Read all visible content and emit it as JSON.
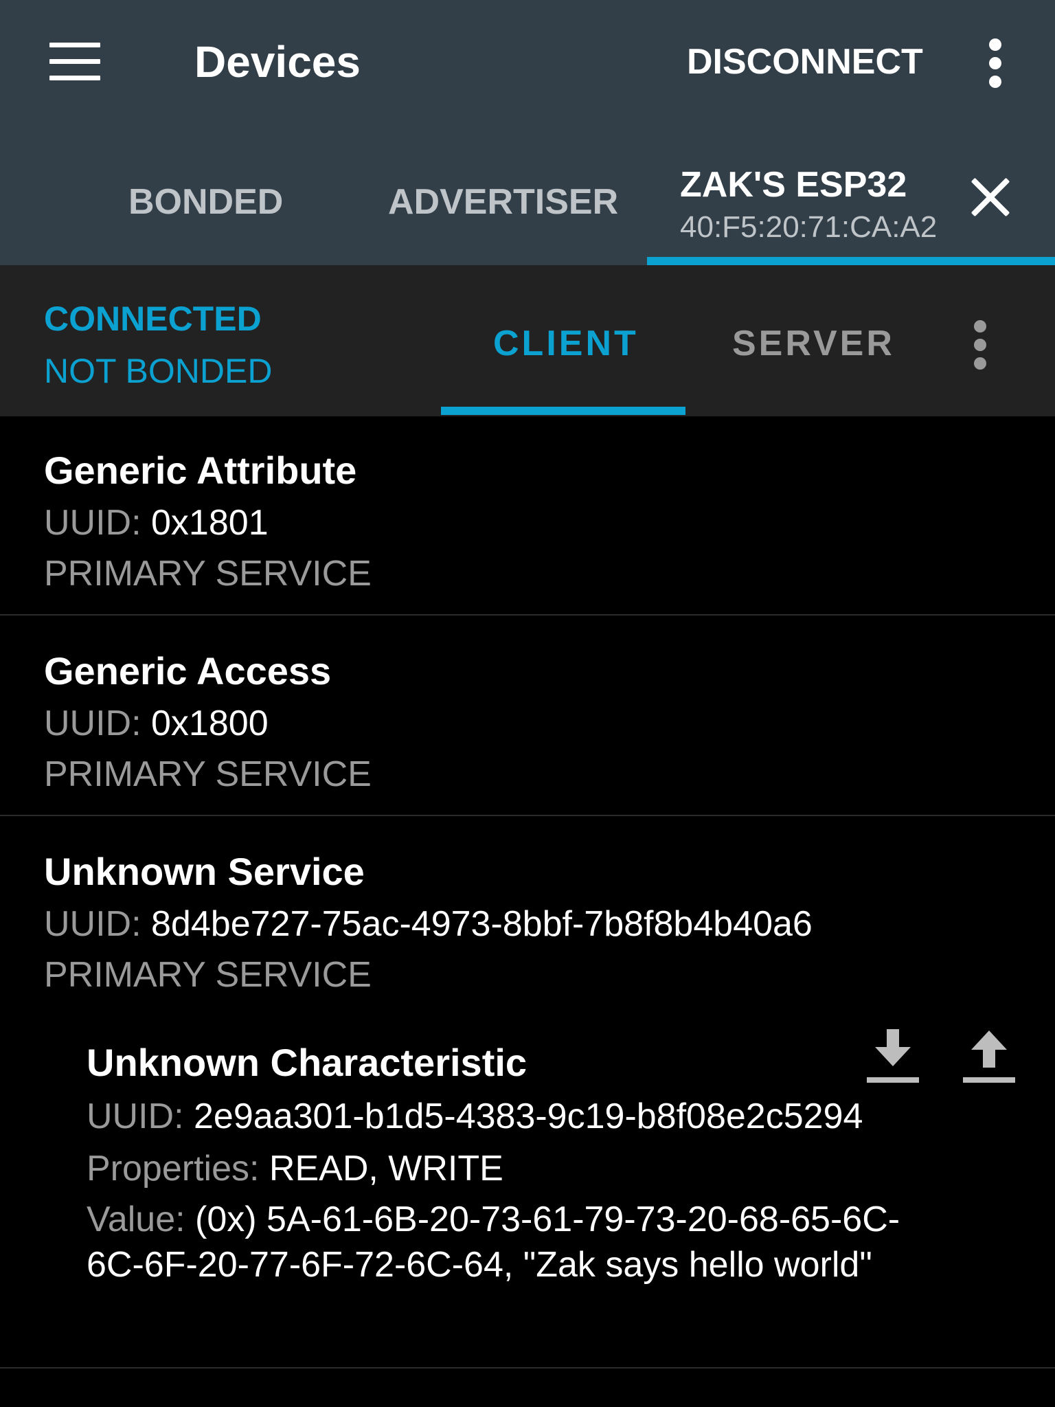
{
  "toolbar": {
    "title": "Devices",
    "disconnect_label": "DISCONNECT",
    "icons": {
      "menu": "hamburger-menu-icon",
      "overflow": "more-vert-icon"
    }
  },
  "device_tabs": {
    "bonded": "BONDED",
    "advertiser": "ADVERTISER",
    "device_name": "ZAK'S ESP32",
    "device_address": "40:F5:20:71:CA:A2",
    "close_icon": "close-icon"
  },
  "connection": {
    "status": "CONNECTED",
    "bond_state": "NOT BONDED",
    "tabs": {
      "client": "CLIENT",
      "server": "SERVER"
    },
    "active_tab": "CLIENT"
  },
  "services": [
    {
      "name": "Generic Attribute",
      "uuid_label": "UUID:",
      "uuid": "0x1801",
      "type": "PRIMARY SERVICE"
    },
    {
      "name": "Generic Access",
      "uuid_label": "UUID:",
      "uuid": "0x1800",
      "type": "PRIMARY SERVICE"
    },
    {
      "name": "Unknown Service",
      "uuid_label": "UUID:",
      "uuid": "8d4be727-75ac-4973-8bbf-7b8f8b4b40a6",
      "type": "PRIMARY SERVICE",
      "characteristic": {
        "name": "Unknown Characteristic",
        "uuid_label": "UUID:",
        "uuid": "2e9aa301-b1d5-4383-9c19-b8f08e2c5294",
        "properties_label": "Properties:",
        "properties": "READ, WRITE",
        "value_label": "Value:",
        "value": "(0x) 5A-61-6B-20-73-61-79-73-20-68-65-6C-6C-6F-20-77-6F-72-6C-64, \"Zak says hello world\"",
        "icons": {
          "read": "download-read-icon",
          "write": "upload-write-icon"
        }
      }
    }
  ],
  "colors": {
    "toolbar_bg": "#323e48",
    "subbar_bg": "#222222",
    "accent": "#0ba2d2",
    "label_gray": "#9a9a9a"
  }
}
